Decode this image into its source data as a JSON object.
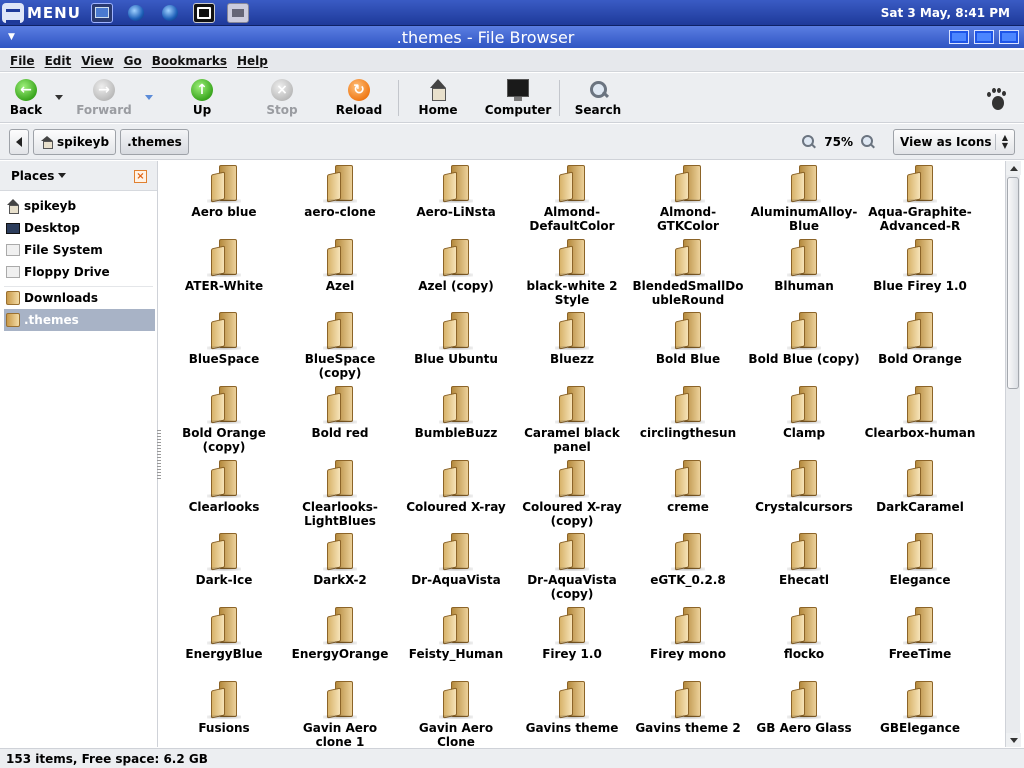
{
  "panel": {
    "menu_label": "MENU",
    "clock": "Sat  3 May,  8:41 PM",
    "launchers": [
      "terminal-icon",
      "globe-icon",
      "browser-icon",
      "workspace-icon",
      "screenshot-icon"
    ]
  },
  "window": {
    "title": ".themes - File Browser"
  },
  "menubar": [
    "File",
    "Edit",
    "View",
    "Go",
    "Bookmarks",
    "Help"
  ],
  "toolbar": {
    "back": "Back",
    "forward": "Forward",
    "up": "Up",
    "stop": "Stop",
    "reload": "Reload",
    "home": "Home",
    "computer": "Computer",
    "search": "Search"
  },
  "location": {
    "path": [
      "spikeyb",
      ".themes"
    ],
    "zoom": "75%",
    "view_mode": "View as Icons"
  },
  "sidebar": {
    "header": "Places",
    "items": [
      {
        "label": "spikeyb",
        "icon": "home-icon"
      },
      {
        "label": "Desktop",
        "icon": "desktop-icon"
      },
      {
        "label": "File System",
        "icon": "drive-icon"
      },
      {
        "label": "Floppy Drive",
        "icon": "floppy-icon"
      },
      {
        "label": "Downloads",
        "icon": "folder-icon"
      },
      {
        "label": ".themes",
        "icon": "folder-icon",
        "selected": true
      }
    ]
  },
  "files": [
    "Aero blue",
    "aero-clone",
    "Aero-LiNsta",
    "Almond-DefaultColor",
    "Almond-GTKColor",
    "AluminumAlloy-Blue",
    "Aqua-Graphite-Advanced-R",
    "ATER-White",
    "Azel",
    "Azel (copy)",
    "black-white 2 Style",
    "BlendedSmallDoubleRound",
    "Blhuman",
    "Blue Firey 1.0",
    "BlueSpace",
    "BlueSpace (copy)",
    "Blue Ubuntu",
    "Bluezz",
    "Bold Blue",
    "Bold Blue (copy)",
    "Bold Orange",
    "Bold Orange (copy)",
    "Bold red",
    "BumbleBuzz",
    "Caramel black panel",
    "circlingthesun",
    "Clamp",
    "Clearbox-human",
    "Clearlooks",
    "Clearlooks-LightBlues",
    "Coloured X-ray",
    "Coloured X-ray (copy)",
    "creme",
    "Crystalcursors",
    "DarkCaramel",
    "Dark-Ice",
    "DarkX-2",
    "Dr-AquaVista",
    "Dr-AquaVista (copy)",
    "eGTK_0.2.8",
    "Ehecatl",
    "Elegance",
    "EnergyBlue",
    "EnergyOrange",
    "Feisty_Human",
    "Firey 1.0",
    "Firey mono",
    "flocko",
    "FreeTime",
    "Fusions",
    "Gavin Aero clone 1",
    "Gavin Aero Clone",
    "Gavins theme",
    "Gavins theme 2",
    "GB Aero Glass",
    "GBElegance"
  ],
  "status": "153 items, Free space: 6.2 GB"
}
